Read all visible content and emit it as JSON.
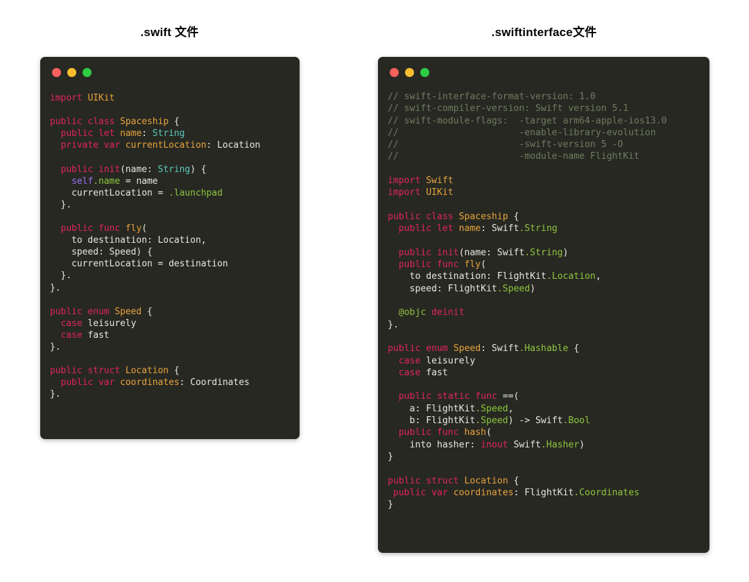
{
  "colors": {
    "page_background": "#ffffff",
    "window_background": "#272822",
    "title_text": "#010101",
    "keyword": "#e0245e",
    "type": "#e8a33d",
    "plain": "#e8e8e3",
    "string": "#5bc8bc",
    "member": "#8ec63f",
    "self": "#9a6ef4",
    "comment": "#6f7c5f",
    "traffic_red": "#f9615c",
    "traffic_yellow": "#f9bd30",
    "traffic_green": "#2ecc44"
  },
  "panels": [
    {
      "id": "swift-file",
      "title": ".swift 文件",
      "traffic_lights": [
        "close-button",
        "minimize-button",
        "maximize-button"
      ],
      "lines": [
        [
          {
            "t": "import ",
            "c": "kw"
          },
          {
            "t": "UIKit",
            "c": "type"
          }
        ],
        [],
        [
          {
            "t": "public class ",
            "c": "kw"
          },
          {
            "t": "Spaceship",
            "c": "type"
          },
          {
            "t": " {",
            "c": "plain"
          }
        ],
        [
          {
            "t": "  ",
            "c": "plain"
          },
          {
            "t": "public let ",
            "c": "kw"
          },
          {
            "t": "name",
            "c": "type"
          },
          {
            "t": ": ",
            "c": "plain"
          },
          {
            "t": "String",
            "c": "string"
          }
        ],
        [
          {
            "t": "  ",
            "c": "plain"
          },
          {
            "t": "private var ",
            "c": "kw"
          },
          {
            "t": "currentLocation",
            "c": "type"
          },
          {
            "t": ": Location",
            "c": "plain"
          }
        ],
        [],
        [
          {
            "t": "  ",
            "c": "plain"
          },
          {
            "t": "public init",
            "c": "kw"
          },
          {
            "t": "(name: ",
            "c": "plain"
          },
          {
            "t": "String",
            "c": "string"
          },
          {
            "t": ") {",
            "c": "plain"
          }
        ],
        [
          {
            "t": "    ",
            "c": "plain"
          },
          {
            "t": "self",
            "c": "self"
          },
          {
            "t": ".name",
            "c": "member"
          },
          {
            "t": " = name",
            "c": "plain"
          }
        ],
        [
          {
            "t": "    currentLocation = ",
            "c": "plain"
          },
          {
            "t": ".launchpad",
            "c": "member"
          }
        ],
        [
          {
            "t": "  }.",
            "c": "plain"
          }
        ],
        [],
        [
          {
            "t": "  ",
            "c": "plain"
          },
          {
            "t": "public func ",
            "c": "kw"
          },
          {
            "t": "fly",
            "c": "type"
          },
          {
            "t": "(",
            "c": "plain"
          }
        ],
        [
          {
            "t": "    to destination: Location,",
            "c": "plain"
          }
        ],
        [
          {
            "t": "    speed: Speed) {",
            "c": "plain"
          }
        ],
        [
          {
            "t": "    currentLocation = destination",
            "c": "plain"
          }
        ],
        [
          {
            "t": "  }.",
            "c": "plain"
          }
        ],
        [
          {
            "t": "}.",
            "c": "plain"
          }
        ],
        [],
        [
          {
            "t": "public enum ",
            "c": "kw"
          },
          {
            "t": "Speed",
            "c": "type"
          },
          {
            "t": " {",
            "c": "plain"
          }
        ],
        [
          {
            "t": "  ",
            "c": "plain"
          },
          {
            "t": "case ",
            "c": "kw"
          },
          {
            "t": "leisurely",
            "c": "plain"
          }
        ],
        [
          {
            "t": "  ",
            "c": "plain"
          },
          {
            "t": "case ",
            "c": "kw"
          },
          {
            "t": "fast",
            "c": "plain"
          }
        ],
        [
          {
            "t": "}.",
            "c": "plain"
          }
        ],
        [],
        [
          {
            "t": "public struct ",
            "c": "kw"
          },
          {
            "t": "Location",
            "c": "type"
          },
          {
            "t": " {",
            "c": "plain"
          }
        ],
        [
          {
            "t": "  ",
            "c": "plain"
          },
          {
            "t": "public var ",
            "c": "kw"
          },
          {
            "t": "coordinates",
            "c": "type"
          },
          {
            "t": ": Coordinates",
            "c": "plain"
          }
        ],
        [
          {
            "t": "}.",
            "c": "plain"
          }
        ]
      ]
    },
    {
      "id": "swiftinterface-file",
      "title": ".swiftinterface文件",
      "traffic_lights": [
        "close-button",
        "minimize-button",
        "maximize-button"
      ],
      "lines": [
        [
          {
            "t": "// swift-interface-format-version: 1.0",
            "c": "comment"
          }
        ],
        [
          {
            "t": "// swift-compiler-version: Swift version 5.1",
            "c": "comment"
          }
        ],
        [
          {
            "t": "// swift-module-flags:  -target arm64-apple-ios13.0",
            "c": "comment"
          }
        ],
        [
          {
            "t": "//                      -enable-library-evolution",
            "c": "comment"
          }
        ],
        [
          {
            "t": "//                      -swift-version 5 -O",
            "c": "comment"
          }
        ],
        [
          {
            "t": "//                      -module-name FlightKit",
            "c": "comment"
          }
        ],
        [],
        [
          {
            "t": "import ",
            "c": "kw"
          },
          {
            "t": "Swift",
            "c": "type"
          }
        ],
        [
          {
            "t": "import ",
            "c": "kw"
          },
          {
            "t": "UIKit",
            "c": "type"
          }
        ],
        [],
        [
          {
            "t": "public class ",
            "c": "kw"
          },
          {
            "t": "Spaceship",
            "c": "type"
          },
          {
            "t": " {",
            "c": "plain"
          }
        ],
        [
          {
            "t": "  ",
            "c": "plain"
          },
          {
            "t": "public let ",
            "c": "kw"
          },
          {
            "t": "name",
            "c": "type"
          },
          {
            "t": ": Swift",
            "c": "plain"
          },
          {
            "t": ".String",
            "c": "member"
          }
        ],
        [],
        [
          {
            "t": "  ",
            "c": "plain"
          },
          {
            "t": "public init",
            "c": "kw"
          },
          {
            "t": "(name: Swift",
            "c": "plain"
          },
          {
            "t": ".String",
            "c": "member"
          },
          {
            "t": ")",
            "c": "plain"
          }
        ],
        [
          {
            "t": "  ",
            "c": "plain"
          },
          {
            "t": "public func ",
            "c": "kw"
          },
          {
            "t": "fly",
            "c": "type"
          },
          {
            "t": "(",
            "c": "plain"
          }
        ],
        [
          {
            "t": "    to destination: FlightKit",
            "c": "plain"
          },
          {
            "t": ".Location",
            "c": "member"
          },
          {
            "t": ",",
            "c": "plain"
          }
        ],
        [
          {
            "t": "    speed: FlightKit",
            "c": "plain"
          },
          {
            "t": ".Speed",
            "c": "member"
          },
          {
            "t": ")",
            "c": "plain"
          }
        ],
        [],
        [
          {
            "t": "  ",
            "c": "plain"
          },
          {
            "t": "@objc ",
            "c": "attr"
          },
          {
            "t": "deinit",
            "c": "kw"
          }
        ],
        [
          {
            "t": "}.",
            "c": "plain"
          }
        ],
        [],
        [
          {
            "t": "public enum ",
            "c": "kw"
          },
          {
            "t": "Speed",
            "c": "type"
          },
          {
            "t": ": Swift",
            "c": "plain"
          },
          {
            "t": ".Hashable",
            "c": "member"
          },
          {
            "t": " {",
            "c": "plain"
          }
        ],
        [
          {
            "t": "  ",
            "c": "plain"
          },
          {
            "t": "case ",
            "c": "kw"
          },
          {
            "t": "leisurely",
            "c": "plain"
          }
        ],
        [
          {
            "t": "  ",
            "c": "plain"
          },
          {
            "t": "case ",
            "c": "kw"
          },
          {
            "t": "fast",
            "c": "plain"
          }
        ],
        [],
        [
          {
            "t": "  ",
            "c": "plain"
          },
          {
            "t": "public static func ",
            "c": "kw"
          },
          {
            "t": "==(",
            "c": "plain"
          }
        ],
        [
          {
            "t": "    a: FlightKit",
            "c": "plain"
          },
          {
            "t": ".Speed",
            "c": "member"
          },
          {
            "t": ",",
            "c": "plain"
          }
        ],
        [
          {
            "t": "    b: FlightKit",
            "c": "plain"
          },
          {
            "t": ".Speed",
            "c": "member"
          },
          {
            "t": ") -> Swift",
            "c": "plain"
          },
          {
            "t": ".Bool",
            "c": "member"
          }
        ],
        [
          {
            "t": "  ",
            "c": "plain"
          },
          {
            "t": "public func ",
            "c": "kw"
          },
          {
            "t": "hash",
            "c": "type"
          },
          {
            "t": "(",
            "c": "plain"
          }
        ],
        [
          {
            "t": "    into hasher: ",
            "c": "plain"
          },
          {
            "t": "inout ",
            "c": "kw"
          },
          {
            "t": "Swift",
            "c": "plain"
          },
          {
            "t": ".Hasher",
            "c": "member"
          },
          {
            "t": ")",
            "c": "plain"
          }
        ],
        [
          {
            "t": "}",
            "c": "plain"
          }
        ],
        [],
        [
          {
            "t": "public struct ",
            "c": "kw"
          },
          {
            "t": "Location",
            "c": "type"
          },
          {
            "t": " {",
            "c": "plain"
          }
        ],
        [
          {
            "t": " ",
            "c": "plain"
          },
          {
            "t": "public var ",
            "c": "kw"
          },
          {
            "t": "coordinates",
            "c": "type"
          },
          {
            "t": ": FlightKit",
            "c": "plain"
          },
          {
            "t": ".Coordinates",
            "c": "member"
          }
        ],
        [
          {
            "t": "}",
            "c": "plain"
          }
        ]
      ]
    }
  ]
}
